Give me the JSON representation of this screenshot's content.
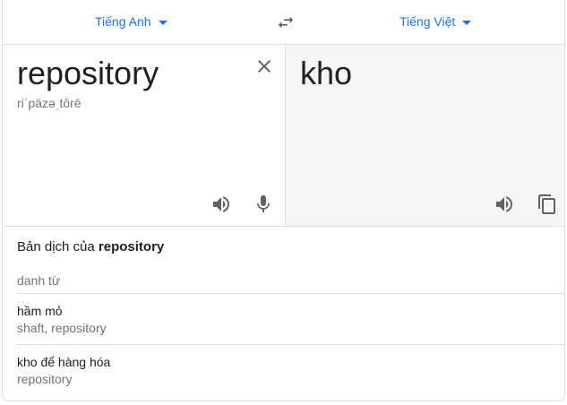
{
  "languages": {
    "source": "Tiếng Anh",
    "target": "Tiếng Việt"
  },
  "source": {
    "text": "repository",
    "phonetic": "riˈpäzəˌtôrē"
  },
  "target": {
    "text": "kho"
  },
  "dictionary": {
    "title_prefix": "Bản dịch của",
    "title_word": "repository",
    "part_of_speech": "danh từ",
    "entries": [
      {
        "word": "hầm mỏ",
        "synonyms": "shaft, repository"
      },
      {
        "word": "kho để hàng hóa",
        "synonyms": "repository"
      }
    ]
  },
  "colors": {
    "accent": "#1a73e8",
    "icon": "#5f6368",
    "secondary_text": "#70757a",
    "target_pane_bg": "#f5f5f5"
  }
}
